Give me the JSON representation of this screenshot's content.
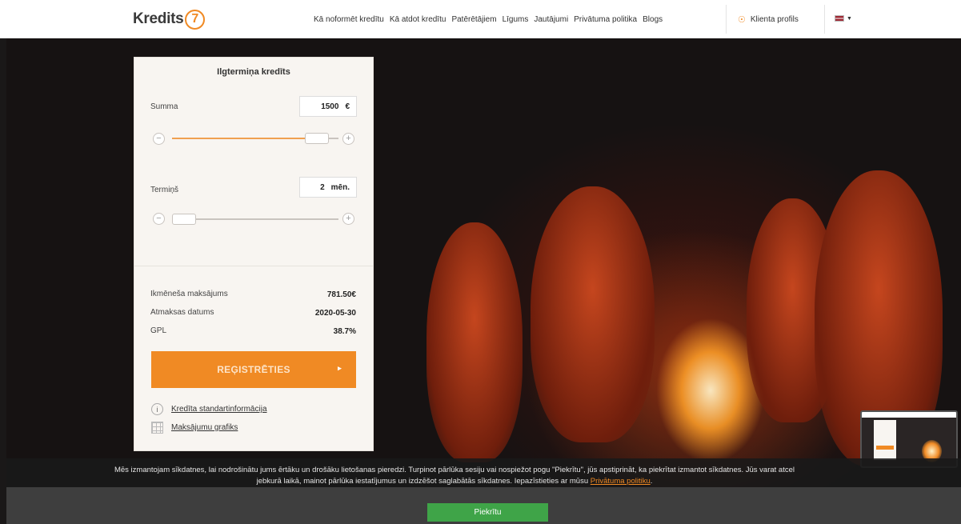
{
  "brand": {
    "name": "Kredits",
    "number": "7",
    "accent": "#f08a24"
  },
  "nav": {
    "items": [
      "Kā noformēt kredītu",
      "Kā atdot kredītu",
      "Patērētājiem",
      "Līgums",
      "Jautājumi",
      "Privātuma politika",
      "Blogs"
    ],
    "profile": "Klienta profils",
    "profile_icon": "user-icon",
    "language_icon": "latvia-flag-icon"
  },
  "calculator": {
    "title": "Ilgtermiņa kredīts",
    "amount": {
      "label": "Summa",
      "value": "1500",
      "unit": "€",
      "minus": "−",
      "plus": "+",
      "level": 0.93
    },
    "term": {
      "label": "Termiņš",
      "value": "2",
      "unit": "mēn.",
      "minus": "−",
      "plus": "+",
      "level": 0.0
    },
    "summary": [
      {
        "label": "Ikmēneša maksājums",
        "value": "781.50€"
      },
      {
        "label": "Atmaksas datums",
        "value": "2020-05-30"
      },
      {
        "label": "GPL",
        "value": "38.7%"
      }
    ],
    "cta": {
      "label": "REĢISTRĒTIES",
      "arrow": "▸"
    },
    "links": [
      {
        "label": "Kredīta standartinformācija",
        "icon": "info-icon"
      },
      {
        "label": "Maksājumu grafiks",
        "icon": "calendar-grid-icon"
      }
    ]
  },
  "cookie": {
    "text_main": "Mēs izmantojam sīkdatnes, lai nodrošinātu jums ērtāku un drošāku lietošanas pieredzi. Turpinot pārlūka sesiju vai nospiežot pogu \"Piekrītu\", jūs apstiprināt, ka piekrītat izmantot sīkdatnes. Jūs varat atcel",
    "text_second": "jebkurā laikā, mainot pārlūka iestatījumus un izdzēšot saglabātās sīkdatnes. Iepazīstieties ar mūsu",
    "link": "Privātuma politiku",
    "end": ".",
    "accept": "Piekrītu"
  }
}
